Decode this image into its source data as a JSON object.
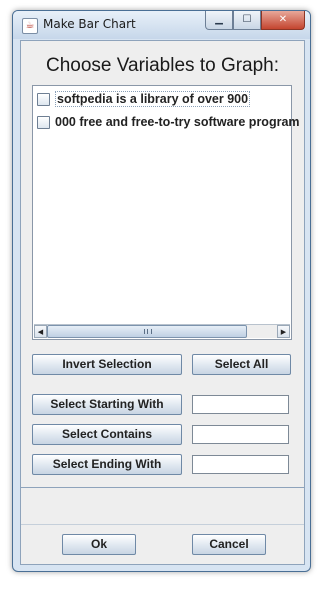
{
  "window": {
    "title": "Make Bar Chart",
    "app_icon": "java-cup-icon",
    "caption": {
      "minimize": "▁",
      "maximize": "☐",
      "close": "✕"
    }
  },
  "heading": "Choose Variables to Graph:",
  "variables": [
    {
      "label": "softpedia is a library of over 900",
      "checked": false
    },
    {
      "label": "000 free and free-to-try software program",
      "checked": false
    }
  ],
  "scrollbar": {
    "left_arrow": "◀",
    "right_arrow": "▶"
  },
  "buttons": {
    "invert_selection": "Invert Selection",
    "select_all": "Select All",
    "select_starting_with": "Select Starting With",
    "select_contains": "Select Contains",
    "select_ending_with": "Select Ending With",
    "ok": "Ok",
    "cancel": "Cancel"
  },
  "fields": {
    "starting_with": "",
    "contains": "",
    "ending_with": ""
  }
}
